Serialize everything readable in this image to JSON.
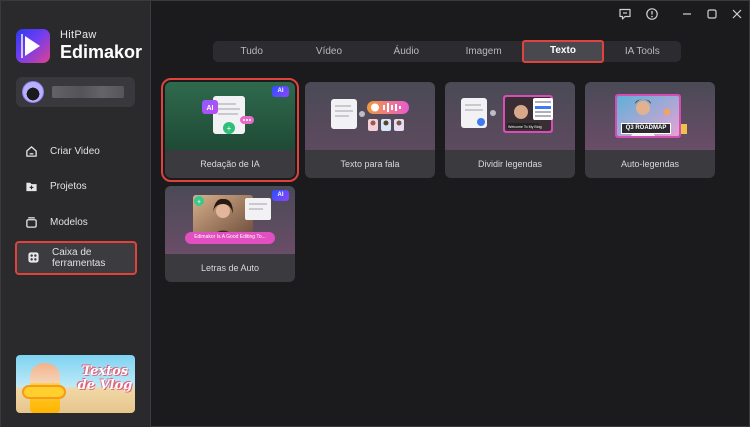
{
  "app": {
    "brand_top": "HitPaw",
    "brand_name": "Edimakor"
  },
  "sidebar": {
    "items": [
      {
        "label": "Criar Video",
        "icon": "home-icon"
      },
      {
        "label": "Projetos",
        "icon": "folder-icon"
      },
      {
        "label": "Modelos",
        "icon": "template-icon"
      },
      {
        "label": "Caixa de ferramentas",
        "icon": "toolbox-icon",
        "active": true
      }
    ],
    "promo_text": "Textos de Vlog"
  },
  "titlebar": {
    "buttons": [
      "feedback-icon",
      "info-icon",
      "minimize-icon",
      "maximize-icon",
      "close-icon"
    ]
  },
  "tabs": [
    {
      "label": "Tudo"
    },
    {
      "label": "Vídeo"
    },
    {
      "label": "Áudio"
    },
    {
      "label": "Imagem"
    },
    {
      "label": "Texto",
      "active": true
    },
    {
      "label": "IA Tools"
    }
  ],
  "tools": [
    {
      "label": "Redação de IA",
      "ai": true,
      "badge": "AI",
      "highlight": true
    },
    {
      "label": "Texto para fala",
      "ai": false
    },
    {
      "label": "Dividir legendas",
      "ai": false,
      "thumb_caption": "Welcome To My Blog"
    },
    {
      "label": "Auto-legendas",
      "ai": false,
      "thumb_caption": "Q3 ROADMAP"
    },
    {
      "label": "Letras de Auto",
      "ai": true,
      "badge": "AI",
      "thumb_caption": "Edimakor Is A Good Editing To..."
    }
  ],
  "colors": {
    "accent_red": "#e0423c",
    "sidebar_bg": "#2a2a2d",
    "main_bg": "#1b1b1d"
  }
}
